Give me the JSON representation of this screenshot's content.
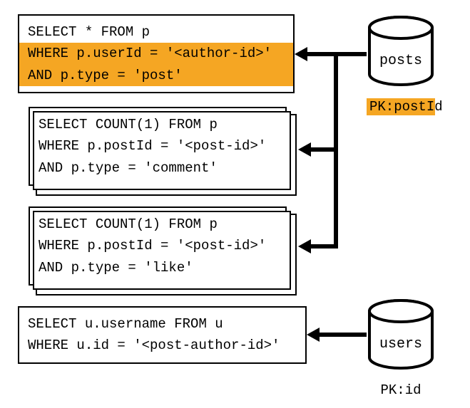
{
  "queries": [
    {
      "lines": [
        {
          "text": "SELECT * FROM p",
          "highlight": false
        },
        {
          "text": "WHERE p.userId = '<author-id>'",
          "highlight": true
        },
        {
          "text": "AND p.type = 'post'",
          "highlight": true
        }
      ],
      "stacked": false
    },
    {
      "lines": [
        {
          "text": "SELECT COUNT(1) FROM p",
          "highlight": false
        },
        {
          "text": "WHERE p.postId = '<post-id>'",
          "highlight": false
        },
        {
          "text": "AND p.type = 'comment'",
          "highlight": false
        }
      ],
      "stacked": true
    },
    {
      "lines": [
        {
          "text": "SELECT COUNT(1) FROM p",
          "highlight": false
        },
        {
          "text": "WHERE p.postId = '<post-id>'",
          "highlight": false
        },
        {
          "text": "AND p.type = 'like'",
          "highlight": false
        }
      ],
      "stacked": true
    },
    {
      "lines": [
        {
          "text": "SELECT u.username FROM u",
          "highlight": false
        },
        {
          "text": "WHERE u.id = '<post-author-id>'",
          "highlight": false
        }
      ],
      "stacked": false
    }
  ],
  "databases": [
    {
      "name": "posts",
      "pk": "PK:postId",
      "pk_highlight": true
    },
    {
      "name": "users",
      "pk": "PK:id",
      "pk_highlight": false
    }
  ]
}
